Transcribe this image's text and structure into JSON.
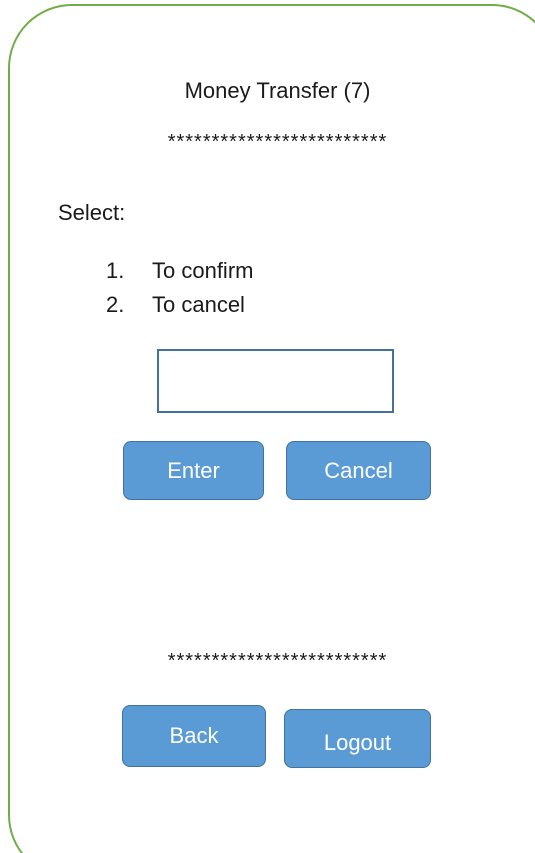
{
  "screen": {
    "title": "Money Transfer (7)",
    "divider_top": "*************************",
    "prompt": "Select:",
    "options": [
      {
        "number": "1.",
        "label": "To confirm"
      },
      {
        "number": "2.",
        "label": "To cancel"
      }
    ],
    "input": {
      "value": "",
      "placeholder": ""
    },
    "enter_label": "Enter",
    "cancel_label": "Cancel",
    "divider_bottom": "*************************",
    "back_label": "Back",
    "logout_label": "Logout"
  },
  "colors": {
    "frame_border": "#70ad47",
    "button_fill": "#5b9bd5",
    "button_border": "#41719c",
    "input_border": "#41719c"
  }
}
